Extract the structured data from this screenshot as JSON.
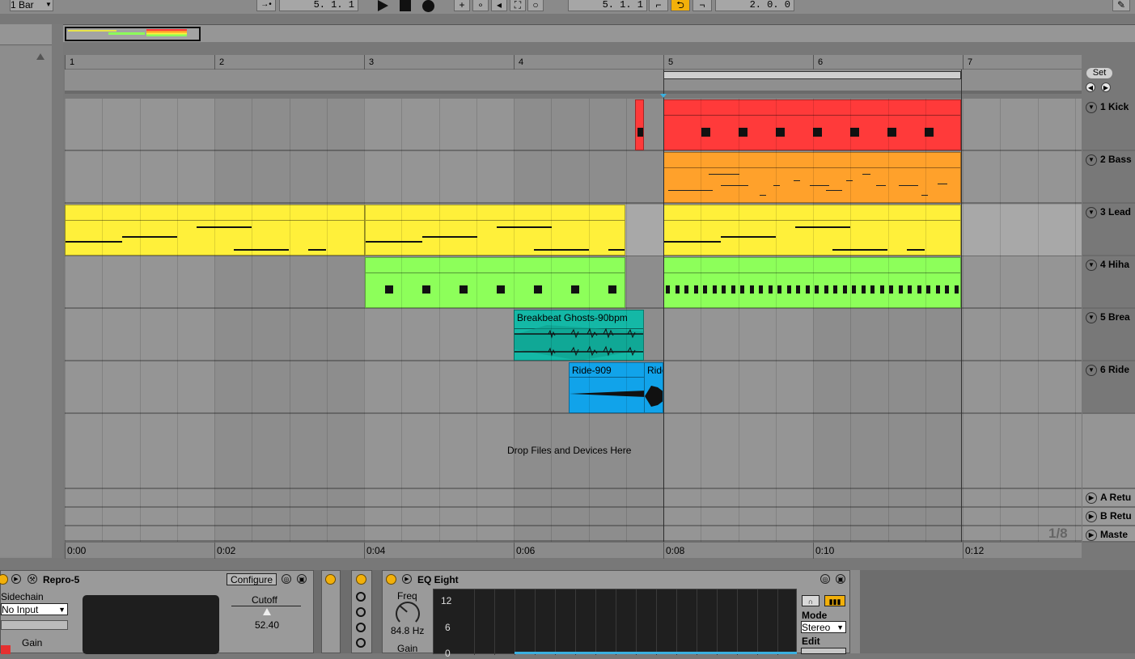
{
  "topbar": {
    "quantize": "1 Bar",
    "arrangement_position": "5.  1.  1",
    "loop_start": "5.  1.  1",
    "loop_length": "2.  0.  0"
  },
  "ruler": {
    "bars": [
      "1",
      "2",
      "3",
      "4",
      "5",
      "6",
      "7"
    ]
  },
  "loop": {
    "set_label": "Set"
  },
  "tracks": [
    {
      "name": "1 Kick",
      "color": "#ff3a3a"
    },
    {
      "name": "2 Bass",
      "color": "#ffa12b"
    },
    {
      "name": "3 Lead",
      "color": "#fff03a"
    },
    {
      "name": "4 Hiha",
      "color": "#8dff5a"
    },
    {
      "name": "5 Brea",
      "color": "#14b8a6"
    },
    {
      "name": "6 Ride",
      "color": "#11a3ea"
    }
  ],
  "clips": {
    "breakbeat": "Breakbeat Ghosts-90bpm",
    "ride": "Ride-909",
    "ride2": "Ride"
  },
  "drop_hint": "Drop Files and Devices Here",
  "returns": [
    "A Retu",
    "B Retu",
    "Maste"
  ],
  "zoom": "1/8",
  "time_axis": [
    "0:00",
    "0:02",
    "0:04",
    "0:06",
    "0:08",
    "0:10",
    "0:12"
  ],
  "devices": {
    "repro": {
      "name": "Repro-5",
      "configure": "Configure",
      "sidechain": "Sidechain",
      "input": "No Input",
      "gain": "Gain",
      "cutoff_label": "Cutoff",
      "cutoff_value": "52.40"
    },
    "eq": {
      "name": "EQ Eight",
      "freq_label": "Freq",
      "freq_value": "84.8 Hz",
      "gain_label": "Gain",
      "db_ticks": [
        "12",
        "6",
        "0"
      ],
      "mode_label": "Mode",
      "mode_value": "Stereo",
      "edit_label": "Edit"
    }
  }
}
